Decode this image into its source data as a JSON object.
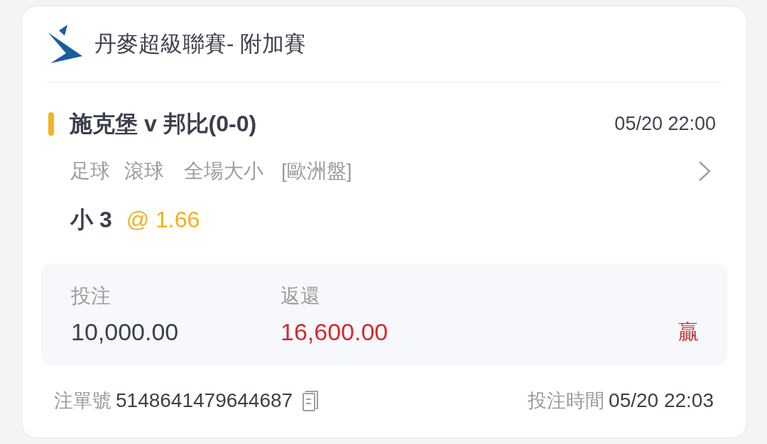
{
  "league": {
    "title": "丹麥超級聯賽- 附加賽"
  },
  "match": {
    "title": "施克堡 v 邦比(0-0)",
    "time": "05/20 22:00",
    "tags": [
      "足球",
      "滾球",
      "全場大小",
      "[歐洲盤]"
    ],
    "selection": "小 3",
    "odds": "@ 1.66"
  },
  "summary": {
    "stake": {
      "label": "投注",
      "value": "10,000.00"
    },
    "return": {
      "label": "返還",
      "value": "16,600.00"
    },
    "result": "贏"
  },
  "footer": {
    "ticket_label": "注單號",
    "ticket_number": "5148641479644687",
    "time_label": "投注時間",
    "time": "05/20 22:03"
  }
}
